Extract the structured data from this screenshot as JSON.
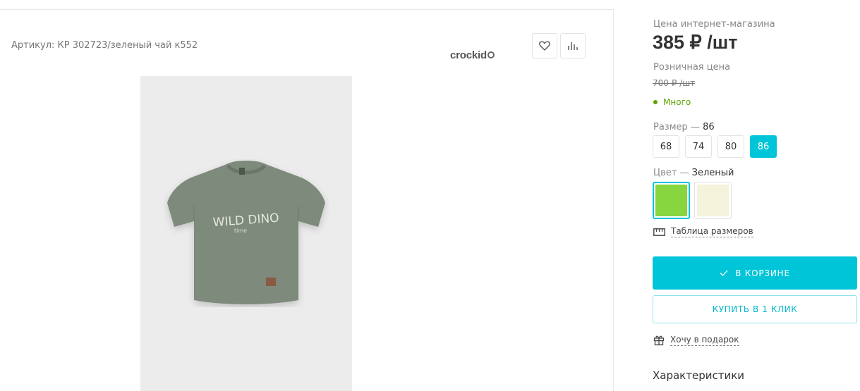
{
  "product": {
    "sku_text": "Артикул: КР 302723/зеленый чай к552",
    "brand_name": "crockid",
    "image_print_main": "WILD DINO",
    "image_print_sub": "time",
    "favorite_icon": "heart-icon",
    "compare_icon": "bar-chart-icon"
  },
  "pricing": {
    "online_label": "Цена интернет-магазина",
    "online_price": "385 ₽ /шт",
    "retail_label": "Розничная цена",
    "retail_price": "700 ₽ /шт",
    "stock_text": "Много"
  },
  "size": {
    "label": "Размер",
    "dash": "—",
    "selected": "86",
    "options": [
      "68",
      "74",
      "80",
      "86"
    ]
  },
  "color": {
    "label": "Цвет",
    "dash": "—",
    "selected": "Зеленый",
    "swatches": [
      "#87d53f",
      "#f4f4dc"
    ]
  },
  "links": {
    "size_table": "Таблица размеров",
    "gift": "Хочу в подарок"
  },
  "actions": {
    "in_cart": "В КОРЗИНЕ",
    "one_click": "КУПИТЬ В 1 КЛИК"
  },
  "section": {
    "characteristics": "Характеристики"
  },
  "colors": {
    "accent": "#00c5d9",
    "stock_green": "#5aa500"
  }
}
